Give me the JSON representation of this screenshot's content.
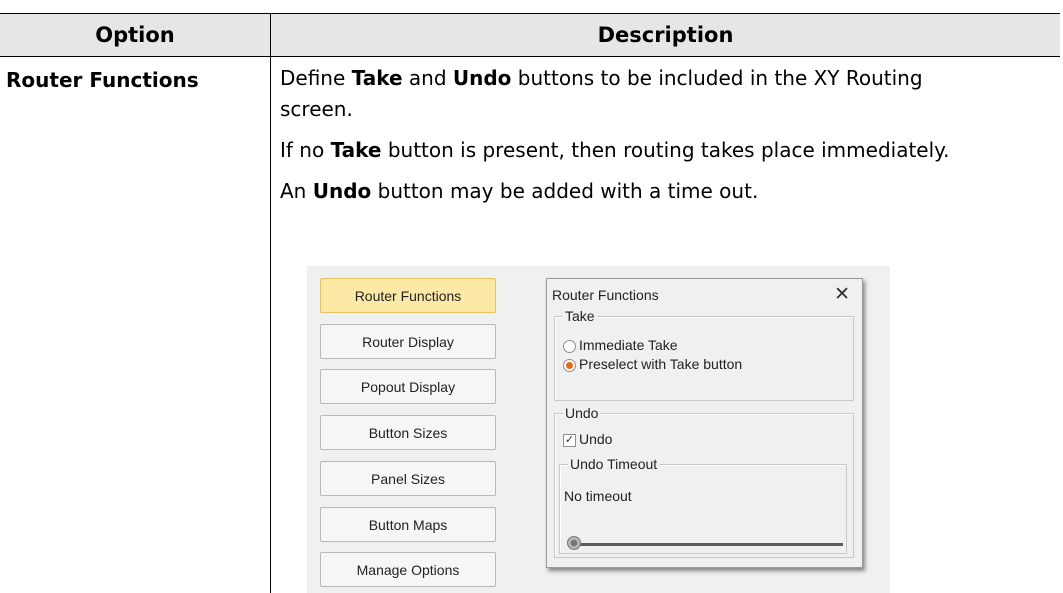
{
  "table": {
    "header": {
      "option": "Option",
      "description": "Description"
    },
    "row": {
      "option": "Router Functions",
      "lines": [
        {
          "parts": [
            [
              "Define ",
              false
            ],
            [
              "Take",
              true
            ],
            [
              " and ",
              false
            ],
            [
              "Undo",
              true
            ],
            [
              " buttons to be included in the XY Routing",
              false
            ]
          ]
        },
        {
          "parts": [
            [
              "screen.",
              false
            ]
          ]
        },
        {
          "parts": [
            [
              "If no ",
              false
            ],
            [
              "Take",
              true
            ],
            [
              " button is present, then routing takes place immediately.",
              false
            ]
          ]
        },
        {
          "parts": [
            [
              "An ",
              false
            ],
            [
              "Undo",
              true
            ],
            [
              " button may be added with a time out.",
              false
            ]
          ]
        }
      ]
    }
  },
  "figure": {
    "menu_buttons": [
      {
        "label": "Router Functions",
        "active": true
      },
      {
        "label": "Router Display",
        "active": false
      },
      {
        "label": "Popout Display",
        "active": false
      },
      {
        "label": "Button Sizes",
        "active": false
      },
      {
        "label": "Panel Sizes",
        "active": false
      },
      {
        "label": "Button Maps",
        "active": false
      },
      {
        "label": "Manage Options",
        "active": false
      }
    ],
    "dialog": {
      "title": "Router Functions",
      "close_glyph": "✕",
      "take_group": {
        "legend": "Take",
        "options": [
          {
            "label": "Immediate Take",
            "selected": false
          },
          {
            "label": "Preselect with Take button",
            "selected": true
          }
        ]
      },
      "undo_group": {
        "legend": "Undo",
        "checkbox_label": "Undo",
        "checkbox_checked": true,
        "checkmark_glyph": "✓",
        "timeout_group": {
          "legend": "Undo Timeout",
          "value_label": "No timeout",
          "slider_value": 0
        }
      }
    },
    "colors": {
      "active_button": "#fde9a6",
      "radio_selected": "#e06a17",
      "header_bg": "#e6e6e6"
    }
  }
}
